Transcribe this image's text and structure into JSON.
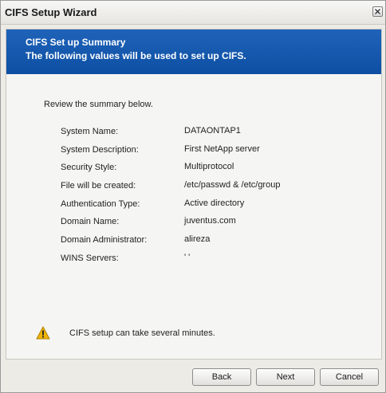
{
  "window": {
    "title": "CIFS Setup Wizard"
  },
  "banner": {
    "title": "CIFS Set up Summary",
    "subtitle": "The following values will be used to set up CIFS."
  },
  "intro": "Review the summary below.",
  "summary": [
    {
      "label": "System Name:",
      "value": "DATAONTAP1"
    },
    {
      "label": "System Description:",
      "value": "First NetApp server"
    },
    {
      "label": "Security Style:",
      "value": "Multiprotocol"
    },
    {
      "label": "File will be created:",
      "value": "/etc/passwd & /etc/group"
    },
    {
      "label": "Authentication Type:",
      "value": "Active directory"
    },
    {
      "label": "Domain Name:",
      "value": "juventus.com"
    },
    {
      "label": "Domain Administrator:",
      "value": "alireza"
    },
    {
      "label": "WINS Servers:",
      "value": "' '"
    }
  ],
  "warning": {
    "icon": "warning-icon",
    "text": "CIFS setup can take several minutes."
  },
  "buttons": {
    "back": "Back",
    "next": "Next",
    "cancel": "Cancel"
  },
  "colors": {
    "banner": "#1458ad",
    "warning": "#f0b400"
  }
}
